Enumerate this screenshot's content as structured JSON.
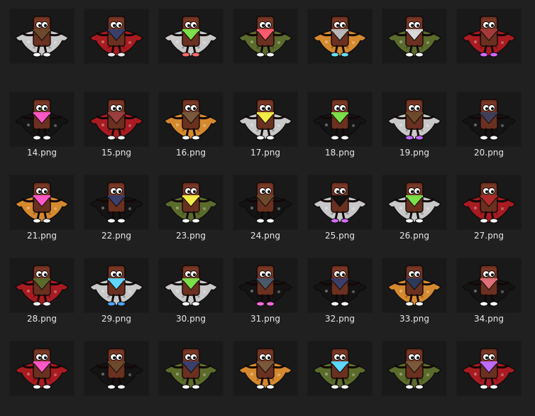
{
  "files": [
    {
      "name": "",
      "cape": "#c8c8c8",
      "bandana": "#6e4a2c",
      "shoe": "#ffffff"
    },
    {
      "name": "",
      "cape": "#a81b20",
      "bandana": "#3a3f6b",
      "shoe": "#e9e9e9"
    },
    {
      "name": "",
      "cape": "#c8c8c8",
      "bandana": "#7be04a",
      "shoe": "#ff6b6b"
    },
    {
      "name": "",
      "cape": "#5b6b2c",
      "bandana": "#ff5a6e",
      "shoe": "#ffffff"
    },
    {
      "name": "",
      "cape": "#d5892e",
      "bandana": "#b8b8b8",
      "shoe": "#66e0ff"
    },
    {
      "name": "",
      "cape": "#5b6b2c",
      "bandana": "#d8d8d8",
      "shoe": "#ffffff"
    },
    {
      "name": "",
      "cape": "#a81b20",
      "bandana": "#a63a3a",
      "shoe": "#d36bff"
    },
    {
      "name": "14.png",
      "cape": "#141414",
      "bandana": "#ff58c9",
      "shoe": "#ffffff"
    },
    {
      "name": "15.png",
      "cape": "#a81b20",
      "bandana": "#9b3f3f",
      "shoe": "#f0f0f0"
    },
    {
      "name": "16.png",
      "cape": "#d5892e",
      "bandana": "#7a5a3a",
      "shoe": "#ffffff"
    },
    {
      "name": "17.png",
      "cape": "#c8c8c8",
      "bandana": "#f3ea4a",
      "shoe": "#ffffff"
    },
    {
      "name": "18.png",
      "cape": "#141414",
      "bandana": "#7be04a",
      "shoe": "#ffffff"
    },
    {
      "name": "19.png",
      "cape": "#c8c8c8",
      "bandana": "#6e4a2c",
      "shoe": "#c06bff"
    },
    {
      "name": "20.png",
      "cape": "#141414",
      "bandana": "#3f3f5a",
      "shoe": "#ffffff"
    },
    {
      "name": "21.png",
      "cape": "#d5892e",
      "bandana": "#ff58c9",
      "shoe": "#ffffff"
    },
    {
      "name": "22.png",
      "cape": "#141414",
      "bandana": "#3a3f6b",
      "shoe": "#ffffff"
    },
    {
      "name": "23.png",
      "cape": "#5b6b2c",
      "bandana": "#f3ea4a",
      "shoe": "#ffffff"
    },
    {
      "name": "24.png",
      "cape": "#141414",
      "bandana": "#6e4a2c",
      "shoe": "#ffffff"
    },
    {
      "name": "25.png",
      "cape": "#c8c8c8",
      "bandana": "#111111",
      "shoe": "#d36bff"
    },
    {
      "name": "26.png",
      "cape": "#c8c8c8",
      "bandana": "#7be04a",
      "shoe": "#ffffff"
    },
    {
      "name": "27.png",
      "cape": "#a81b20",
      "bandana": "#b02a2a",
      "shoe": "#ffffff"
    },
    {
      "name": "28.png",
      "cape": "#a81b20",
      "bandana": "#5b6b2c",
      "shoe": "#ffffff"
    },
    {
      "name": "29.png",
      "cape": "#c8c8c8",
      "bandana": "#5fd7ff",
      "shoe": "#4da3ff"
    },
    {
      "name": "30.png",
      "cape": "#c8c8c8",
      "bandana": "#7be04a",
      "shoe": "#ffffff"
    },
    {
      "name": "31.png",
      "cape": "#141414",
      "bandana": "#4a5a6a",
      "shoe": "#ff6bd6"
    },
    {
      "name": "32.png",
      "cape": "#141414",
      "bandana": "#3a3f6b",
      "shoe": "#ffffff"
    },
    {
      "name": "33.png",
      "cape": "#d5892e",
      "bandana": "#2e3a5a",
      "shoe": "#ffffff"
    },
    {
      "name": "34.png",
      "cape": "#141414",
      "bandana": "#e0707a",
      "shoe": "#ffffff"
    },
    {
      "name": "",
      "cape": "#a81b20",
      "bandana": "#ff58c9",
      "shoe": "#ffffff"
    },
    {
      "name": "",
      "cape": "#141414",
      "bandana": "#6e4a2c",
      "shoe": "#ffffff"
    },
    {
      "name": "",
      "cape": "#5b6b2c",
      "bandana": "#3a3f6b",
      "shoe": "#ffffff"
    },
    {
      "name": "",
      "cape": "#d5892e",
      "bandana": "#7a5a3a",
      "shoe": "#ffffff"
    },
    {
      "name": "",
      "cape": "#5b6b2c",
      "bandana": "#5fd7ff",
      "shoe": "#ffffff"
    },
    {
      "name": "",
      "cape": "#5b6b2c",
      "bandana": "#7a5a3a",
      "shoe": "#ffffff"
    },
    {
      "name": "",
      "cape": "#a81b20",
      "bandana": "#c06bff",
      "shoe": "#ffffff"
    }
  ]
}
